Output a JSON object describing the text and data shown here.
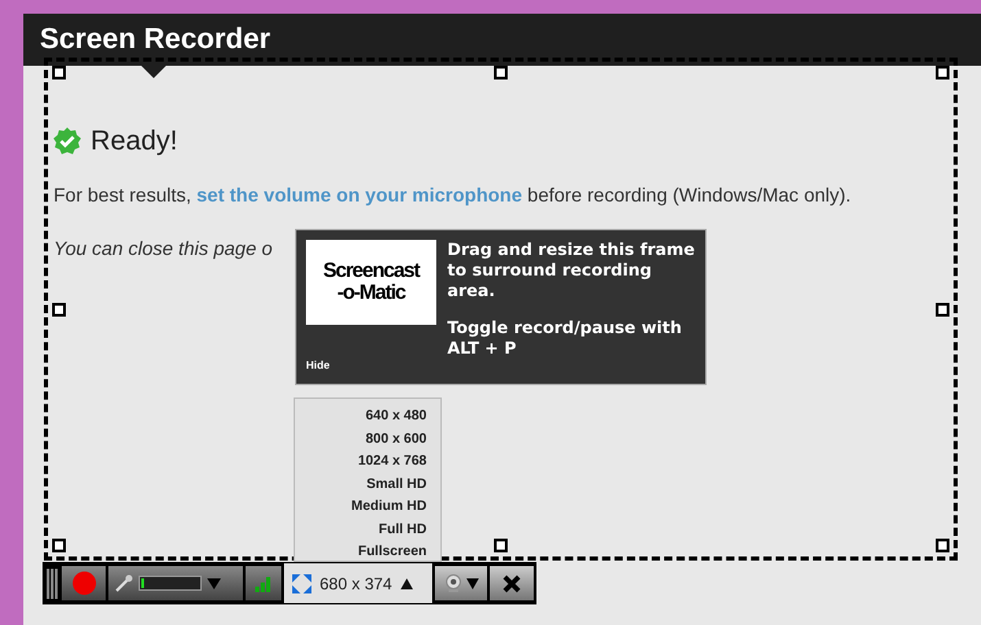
{
  "header": {
    "title": "Screen Recorder"
  },
  "status": {
    "title": "Ready!"
  },
  "intro": {
    "before": "For best results, ",
    "link": "set the volume on your microphone",
    "after": " before recording (Windows/Mac only)."
  },
  "note": "You can close this page o",
  "tooltip": {
    "logo_lines": [
      "Screencast",
      "-o-Matic"
    ],
    "message": "Drag and resize this frame to surround recording area.",
    "hint": "Toggle record/pause with ALT + P",
    "hide": "Hide"
  },
  "size_menu": [
    "640 x 480",
    "800 x 600",
    "1024 x 768",
    "Small HD",
    "Medium HD",
    "Full HD",
    "Fullscreen"
  ],
  "toolbar": {
    "mic_level": {
      "level": 0.05
    },
    "size": "680 x 374"
  }
}
